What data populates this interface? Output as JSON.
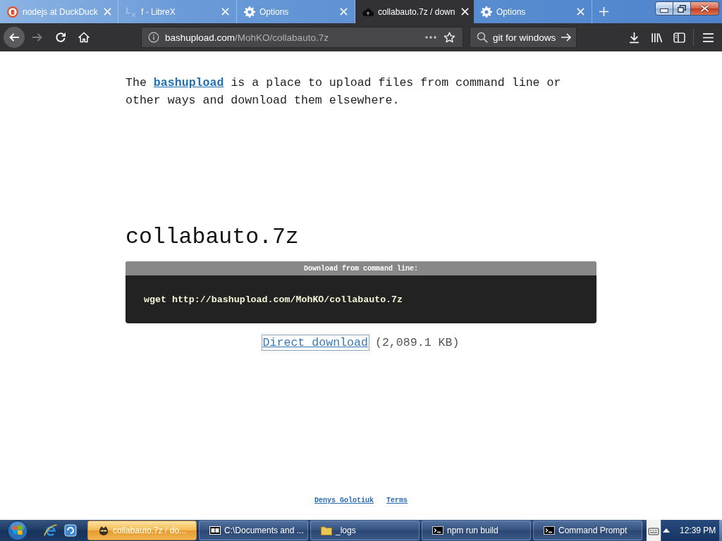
{
  "browser": {
    "tabs": [
      {
        "kind": "duck",
        "title": "nodejs at DuckDuck",
        "selected": false
      },
      {
        "kind": "librex",
        "title": "f - LibreX",
        "selected": false
      },
      {
        "kind": "gear",
        "title": "Options",
        "selected": false
      },
      {
        "kind": "cloud",
        "title": "collabauto.7z / down",
        "selected": true
      },
      {
        "kind": "gear",
        "title": "Options",
        "selected": false
      }
    ],
    "nav_buttons": [
      {
        "kind": "back",
        "disabled": false,
        "hovered": true
      },
      {
        "kind": "forward",
        "disabled": true,
        "hovered": false
      },
      {
        "kind": "reload",
        "disabled": false,
        "hovered": false
      },
      {
        "kind": "home",
        "disabled": false,
        "hovered": false
      }
    ],
    "address_bar": {
      "host": "bashupload.com",
      "path": "/MohKO/collabauto.7z"
    },
    "search_field": {
      "value": "git for windows"
    }
  },
  "page": {
    "intro": {
      "before": "The ",
      "link": "bashupload",
      "after": " is a place to upload files from command line or other ways and download them elsewhere."
    },
    "file_name": "collabauto.7z",
    "command_box": {
      "title": "Download from command line:",
      "command": "wget http://bashupload.com/MohKO/collabauto.7z"
    },
    "direct_download": {
      "link": "Direct download",
      "size": "(2,089.1 KB)",
      "focused": true
    },
    "footer_links": [
      "Denys Golotiuk",
      "Terms"
    ]
  },
  "taskbar": {
    "windows": [
      {
        "kind": "animal",
        "label": "collabauto.7z / do...",
        "selected": true
      },
      {
        "kind": "archive",
        "label": "C:\\Documents and ...",
        "selected": false
      },
      {
        "kind": "folder",
        "label": "_logs",
        "selected": false
      },
      {
        "kind": "terminal",
        "label": "npm run build",
        "selected": false
      },
      {
        "kind": "terminal",
        "label": "Command Prompt",
        "selected": false
      }
    ],
    "clock": "12:39 PM"
  }
}
